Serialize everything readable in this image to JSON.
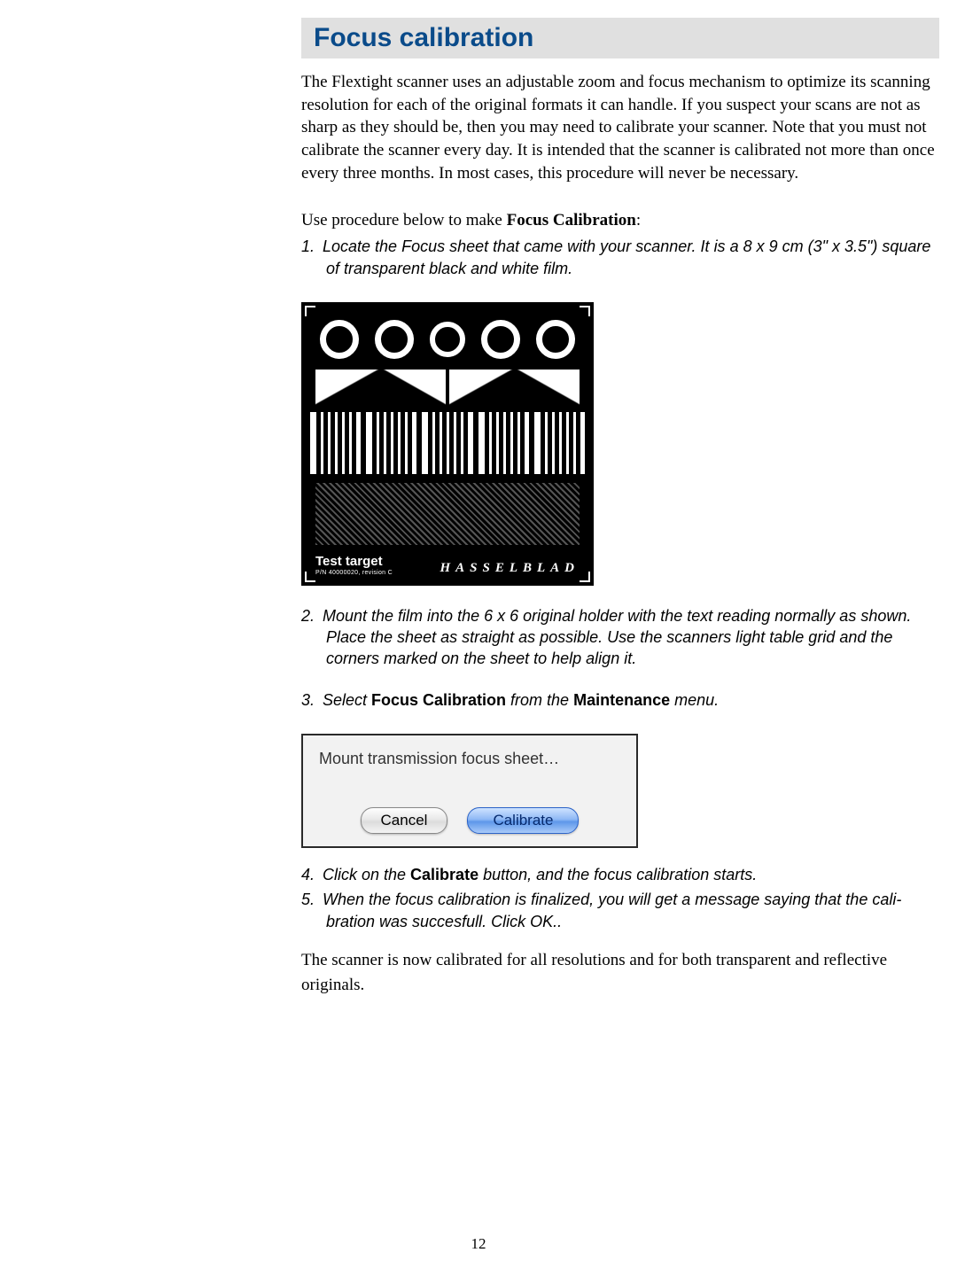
{
  "title": "Focus calibration",
  "intro": "The Flextight scanner uses an adjustable zoom and focus mechanism to optimize its scanning resolution for each of the original formats it can handle. If you suspect your scans are not as sharp as they should be, then you may need to calibrate your scanner. Note that you must not calibrate the scanner every day. It is intended that the scanner is calibrated not more than once every three months. In most cases, this procedure will never be necessary.",
  "lead_in_pre": "Use procedure below to make ",
  "lead_in_bold": "Focus Calibration",
  "lead_in_post": ":",
  "steps": {
    "s1_num": "1.",
    "s1": "Locate the Focus sheet that came with your scanner. It is a 8 x 9 cm (3\" x 3.5\") square of transparent  black and white film.",
    "s2_num": "2.",
    "s2": "Mount the film into the 6 x 6 original holder with the text reading normally as shown. Place the sheet as straight as possible. Use the scanners light table grid and the corners marked on the sheet to help align it.",
    "s3_num": "3.",
    "s3_pre": "Select ",
    "s3_b1": "Focus Calibration",
    "s3_mid": " from the ",
    "s3_b2": "Maintenance",
    "s3_post": " menu.",
    "s4_num": "4.",
    "s4_pre": "Click on the ",
    "s4_b": "Calibrate",
    "s4_post": " button, and the focus calibration starts.",
    "s5_num": "5.",
    "s5": "When the focus calibration is finalized, you will get a message saying that the cali-bration was succesfull. Click OK.."
  },
  "target": {
    "label": "Test target",
    "pn": "P/N 40000020, revision C",
    "brand": "HASSELBLAD"
  },
  "dialog": {
    "message": "Mount transmission focus sheet…",
    "cancel": "Cancel",
    "calibrate": "Calibrate"
  },
  "closing": "The scanner is now calibrated for all resolutions and for both transparent and reflective originals.",
  "page_number": "12"
}
